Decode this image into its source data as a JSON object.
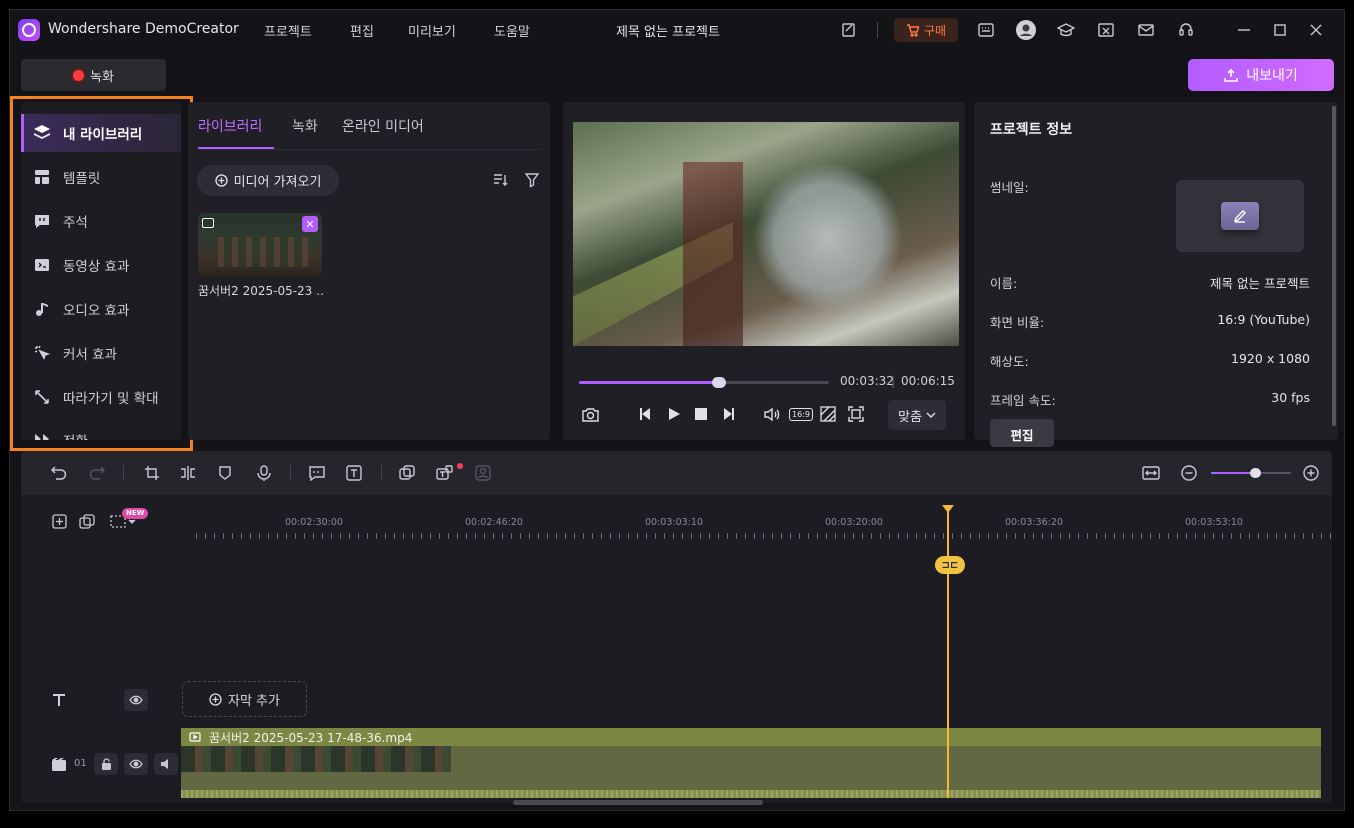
{
  "app": {
    "name": "Wondershare DemoCreator",
    "menu": [
      "프로젝트",
      "편집",
      "미리보기",
      "도움말"
    ],
    "project_title": "제목 없는 프로젝트",
    "buy_label": "구매"
  },
  "top": {
    "record_label": "녹화",
    "export_label": "내보내기"
  },
  "sidebar": {
    "items": [
      {
        "label": "내 라이브러리",
        "icon": "layers-icon",
        "active": true
      },
      {
        "label": "템플릿",
        "icon": "template-icon"
      },
      {
        "label": "주석",
        "icon": "annotation-icon"
      },
      {
        "label": "동영상 효과",
        "icon": "video-effect-icon"
      },
      {
        "label": "오디오 효과",
        "icon": "music-note-icon"
      },
      {
        "label": "커서 효과",
        "icon": "cursor-effect-icon"
      },
      {
        "label": "따라가기 및 확대",
        "icon": "zoom-pan-icon"
      },
      {
        "label": "전환",
        "icon": "transition-icon"
      }
    ]
  },
  "library": {
    "tabs": [
      "라이브러리",
      "녹화",
      "온라인 미디어"
    ],
    "import_label": "미디어 가져오기",
    "media": [
      {
        "name": "꿈서버2 2025-05-23 …"
      }
    ]
  },
  "preview": {
    "current_time": "00:03:32",
    "total_time": "00:06:15",
    "progress": 0.56,
    "ratio_badge": "16:9",
    "fit_label": "맞춤"
  },
  "info": {
    "title": "프로젝트 정보",
    "rows": [
      {
        "label": "썸네일:",
        "value": ""
      },
      {
        "label": "이름:",
        "value": "제목 없는 프로젝트"
      },
      {
        "label": "화면 비율:",
        "value": "16:9 (YouTube)"
      },
      {
        "label": "해상도:",
        "value": "1920 x 1080"
      },
      {
        "label": "프레임 속도:",
        "value": "30 fps"
      }
    ],
    "edit_label": "편집"
  },
  "timeline": {
    "new_badge": "NEW",
    "ruler": [
      "00:02:30:00",
      "00:02:46:20",
      "00:03:03:10",
      "00:03:20:00",
      "00:03:36:20",
      "00:03:53:10"
    ],
    "zoom_level": 0.55,
    "subtitle_add_label": "자막 추가",
    "track_number": "01",
    "clip_name": "꿈서버2 2025-05-23 17-48-36.mp4",
    "split_badge": "⊐⊏"
  },
  "colors": {
    "accent": "#b35cff",
    "playhead": "#f2b83c",
    "highlight": "#f58220",
    "clip": "#7c8744"
  }
}
